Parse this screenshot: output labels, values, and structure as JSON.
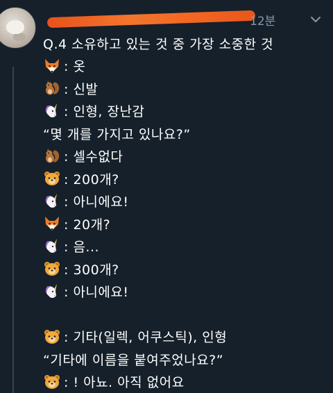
{
  "tweet": {
    "time": "12분",
    "handle_partial": "@"
  },
  "lines": [
    {
      "speaker": "",
      "text": "Q.4 소유하고 있는 것 중 가장 소중한 것"
    },
    {
      "speaker": "fox",
      "text": ": 옷"
    },
    {
      "speaker": "squirrel",
      "text": ": 신발"
    },
    {
      "speaker": "unicorn",
      "text": ": 인형, 장난감"
    },
    {
      "speaker": "",
      "text": "“몇 개를 가지고 있나요?”"
    },
    {
      "speaker": "squirrel",
      "text": ": 셀수없다"
    },
    {
      "speaker": "bear",
      "text": ": 200개?"
    },
    {
      "speaker": "unicorn",
      "text": ": 아니에요!"
    },
    {
      "speaker": "fox",
      "text": ": 20개?"
    },
    {
      "speaker": "unicorn",
      "text": ": 음..."
    },
    {
      "speaker": "bear",
      "text": ": 300개?"
    },
    {
      "speaker": "unicorn",
      "text": ": 아니에요!"
    },
    {
      "speaker": "",
      "text": ""
    },
    {
      "speaker": "bear",
      "text": ": 기타(일렉, 어쿠스틱), 인형"
    },
    {
      "speaker": "",
      "text": "“기타에 이름을 붙여주었나요?”"
    },
    {
      "speaker": "bear",
      "text": ": ! 아뇨. 아직 없어요"
    }
  ],
  "icons": {
    "fox": "fox-face-icon",
    "squirrel": "squirrel-icon",
    "unicorn": "unicorn-face-icon",
    "bear": "bear-face-icon"
  }
}
